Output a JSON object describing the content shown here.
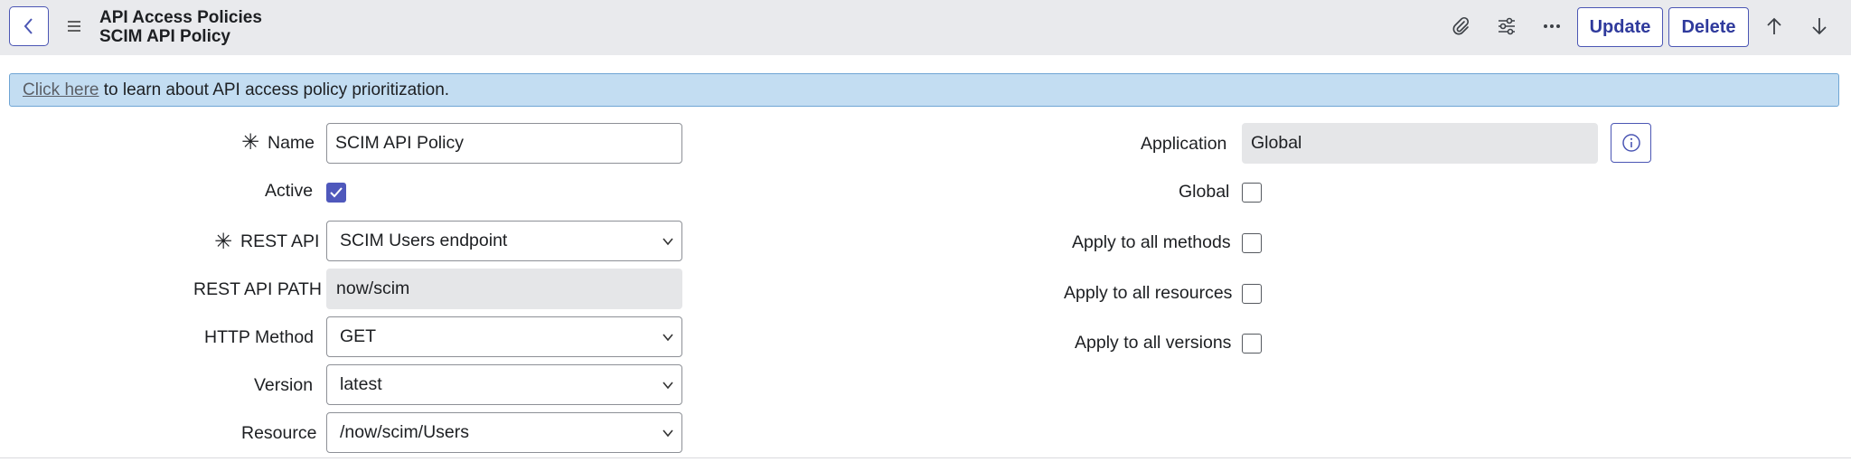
{
  "header": {
    "table_title": "API Access Policies",
    "record_title": "SCIM API Policy",
    "update_label": "Update",
    "delete_label": "Delete"
  },
  "banner": {
    "link_text": "Click here",
    "text": " to learn about API access policy prioritization."
  },
  "form": {
    "name": {
      "label": "Name",
      "value": "SCIM API Policy"
    },
    "active": {
      "label": "Active",
      "checked": true
    },
    "rest_api": {
      "label": "REST API",
      "value": "SCIM Users endpoint"
    },
    "rest_api_path": {
      "label": "REST API PATH",
      "value": "now/scim"
    },
    "http_method": {
      "label": "HTTP Method",
      "value": "GET"
    },
    "version": {
      "label": "Version",
      "value": "latest"
    },
    "resource": {
      "label": "Resource",
      "value": "/now/scim/Users"
    },
    "application": {
      "label": "Application",
      "value": "Global"
    },
    "global": {
      "label": "Global",
      "checked": false
    },
    "apply_all_methods": {
      "label": "Apply to all methods",
      "checked": false
    },
    "apply_all_resources": {
      "label": "Apply to all resources",
      "checked": false
    },
    "apply_all_versions": {
      "label": "Apply to all versions",
      "checked": false
    }
  },
  "colors": {
    "accent": "#4b56b4",
    "header_bg": "#e9eaed",
    "banner_bg": "#c3ddf2"
  },
  "icons": [
    "chevron-left-icon",
    "hamburger-menu-icon",
    "paperclip-icon",
    "sliders-icon",
    "more-horizontal-icon",
    "arrow-up-icon",
    "arrow-down-icon",
    "info-icon",
    "chevron-down-icon",
    "checkmark-icon"
  ]
}
